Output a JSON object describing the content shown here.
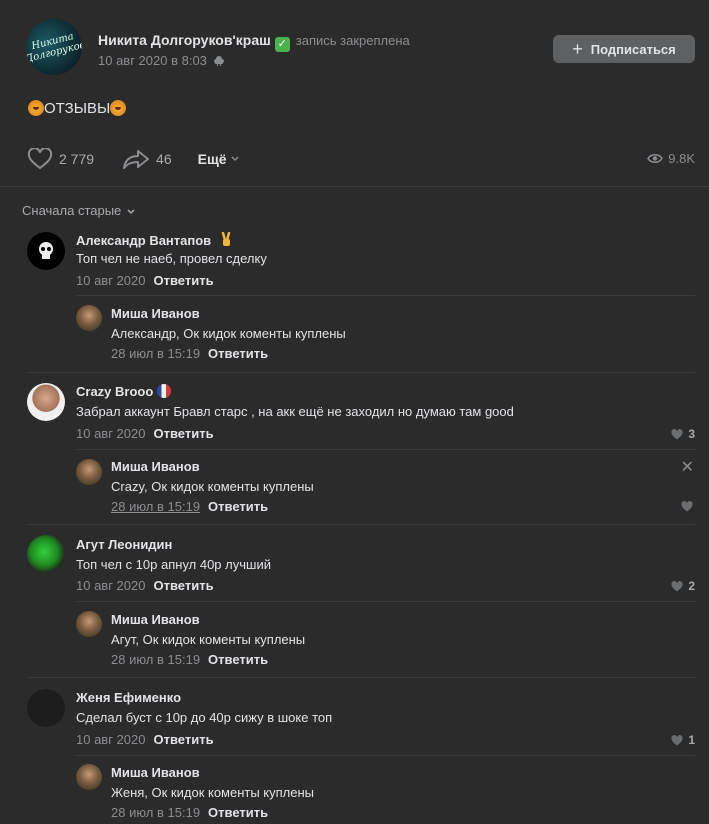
{
  "post": {
    "author": "Никита Долгоруков'краш",
    "verified_mark": "✓",
    "pinned_label": "запись закреплена",
    "date": "10 авг 2020 в 8:03",
    "avatar_text": "Никита Долгоруков",
    "subscribe_label": "Подписаться",
    "text": "ОТЗЫВЫ",
    "likes": "2 779",
    "shares": "46",
    "more_label": "Ещё",
    "views": "9.8K"
  },
  "sort_label": "Сначала старые",
  "comments": [
    {
      "name": "Александр Вантапов",
      "text": "Топ чел не наеб, провел сделку",
      "date": "10 авг 2020",
      "reply_label": "Ответить",
      "likes": "",
      "reply": {
        "name": "Миша Иванов",
        "text": "Александр, Ок кидок коменты куплены",
        "date": "28 июл в 15:19",
        "reply_label": "Ответить"
      }
    },
    {
      "name": "Crazy Brooo",
      "text": "Забрал аккаунт Бравл старс , на акк ещё не заходил но думаю там good",
      "date": "10 авг 2020",
      "reply_label": "Ответить",
      "likes": "3",
      "reply": {
        "name": "Миша Иванов",
        "text": "Crazy, Ок кидок коменты куплены",
        "date": "28 июл в 15:19",
        "reply_label": "Ответить"
      }
    },
    {
      "name": "Агут Леонидин",
      "text": "Топ чел с 10р апнул 40р лучший",
      "date": "10 авг 2020",
      "reply_label": "Ответить",
      "likes": "2",
      "reply": {
        "name": "Миша Иванов",
        "text": "Агут, Ок кидок коменты куплены",
        "date": "28 июл в 15:19",
        "reply_label": "Ответить"
      }
    },
    {
      "name": "Женя Ефименко",
      "text": "Сделал буст с 10р до 40р сижу в шоке топ",
      "date": "10 авг 2020",
      "reply_label": "Ответить",
      "likes": "1",
      "reply": {
        "name": "Миша Иванов",
        "text": "Женя, Ок кидок коменты куплены",
        "date": "28 июл в 15:19",
        "reply_label": "Ответить"
      }
    }
  ],
  "colors": {
    "background": "#2b2b2c",
    "text": "#e1e3e6",
    "muted": "#8b8d90",
    "verified": "#4bb34b",
    "button": "#5f6061"
  }
}
